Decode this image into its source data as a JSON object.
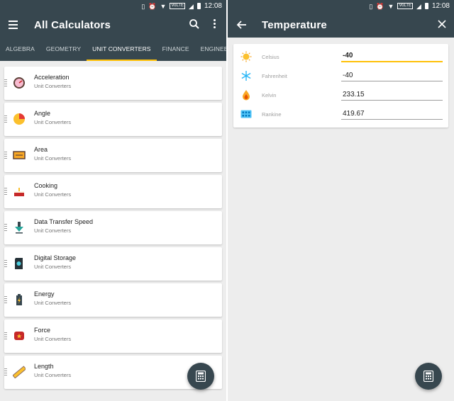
{
  "left": {
    "status": {
      "time": "12:08",
      "network": "VoLTE"
    },
    "title": "All Calculators",
    "tabs": [
      "ALGEBRA",
      "GEOMETRY",
      "UNIT CONVERTERS",
      "FINANCE",
      "ENGINEERING"
    ],
    "active_tab": "UNIT CONVERTERS",
    "items": [
      {
        "label": "Acceleration",
        "sub": "Unit Converters",
        "icon": "speedometer-icon"
      },
      {
        "label": "Angle",
        "sub": "Unit Converters",
        "icon": "pie-angle-icon"
      },
      {
        "label": "Area",
        "sub": "Unit Converters",
        "icon": "area-icon"
      },
      {
        "label": "Cooking",
        "sub": "Unit Converters",
        "icon": "cake-icon"
      },
      {
        "label": "Data Transfer Speed",
        "sub": "Unit Converters",
        "icon": "download-icon"
      },
      {
        "label": "Digital Storage",
        "sub": "Unit Converters",
        "icon": "sd-card-icon"
      },
      {
        "label": "Energy",
        "sub": "Unit Converters",
        "icon": "battery-icon"
      },
      {
        "label": "Force",
        "sub": "Unit Converters",
        "icon": "fist-icon"
      },
      {
        "label": "Length",
        "sub": "Unit Converters",
        "icon": "ruler-icon"
      }
    ]
  },
  "right": {
    "status": {
      "time": "12:08",
      "network": "VoLTE"
    },
    "title": "Temperature",
    "rows": [
      {
        "label": "Celsius",
        "value": "-40",
        "icon": "sun-icon"
      },
      {
        "label": "Fahrenheit",
        "value": "-40",
        "icon": "snowflake-icon"
      },
      {
        "label": "Kelvin",
        "value": "233.15",
        "icon": "flame-icon"
      },
      {
        "label": "Rankine",
        "value": "419.67",
        "icon": "grid-icon"
      }
    ]
  },
  "colors": {
    "primary": "#37474f",
    "accent": "#ffc107",
    "background": "#ededed"
  }
}
